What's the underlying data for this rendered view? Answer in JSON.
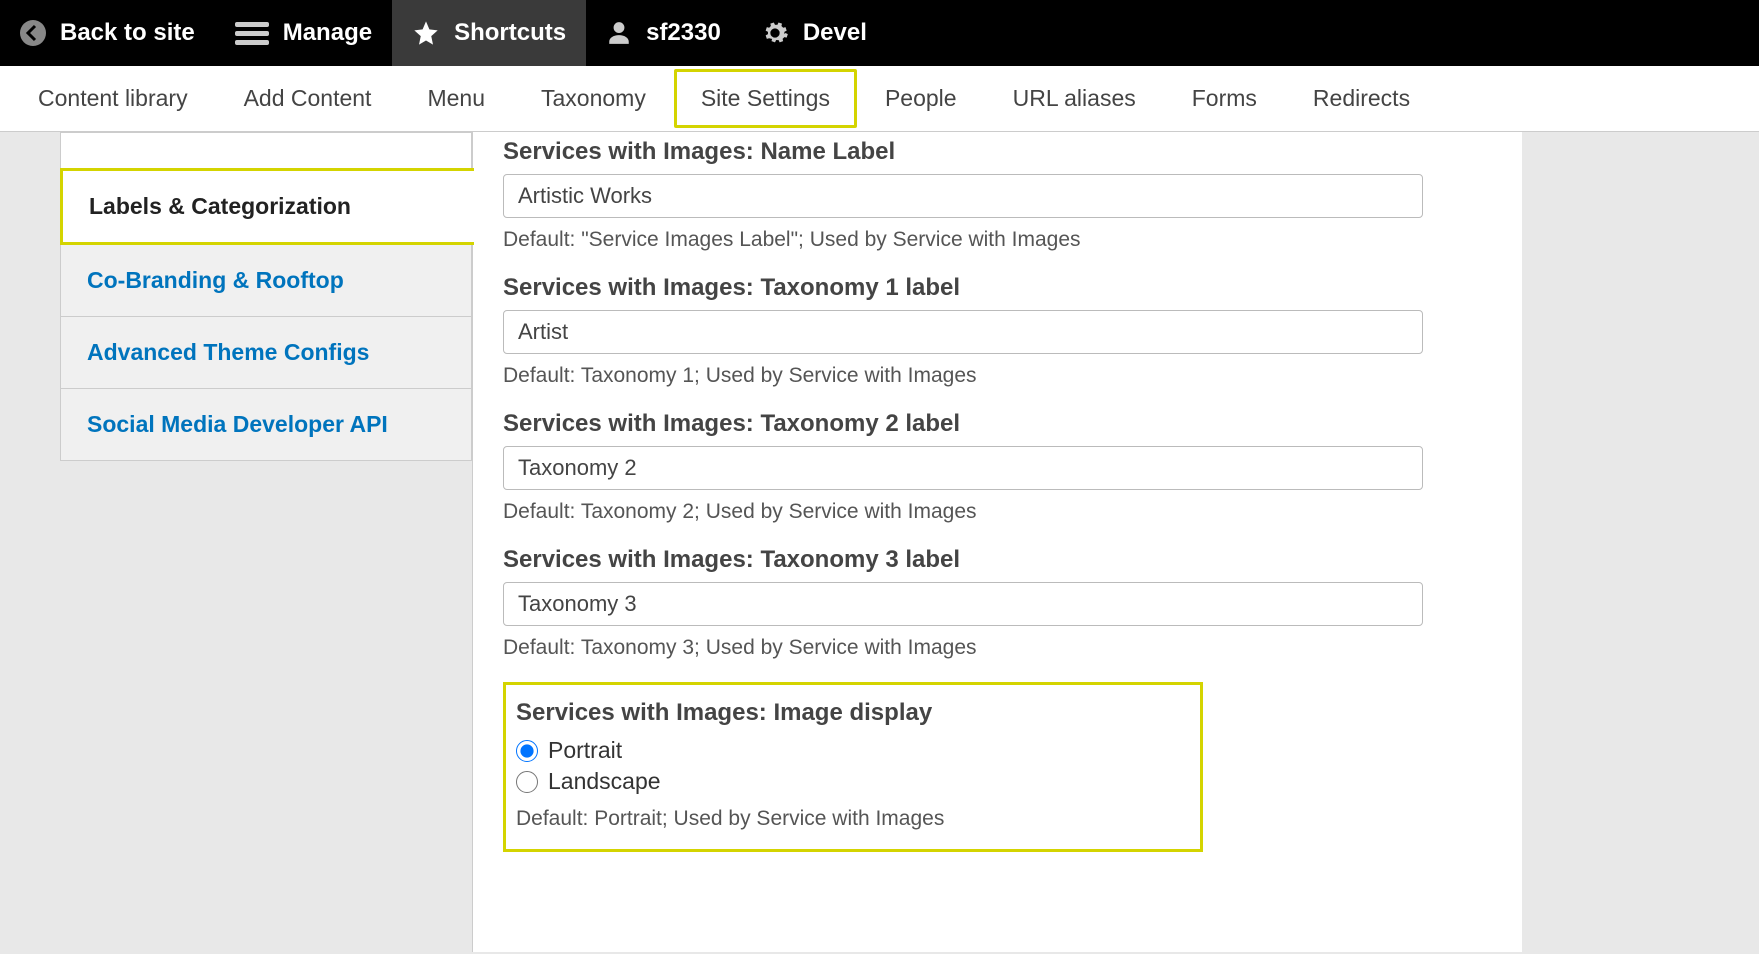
{
  "toolbar": {
    "back": "Back to site",
    "manage": "Manage",
    "shortcuts": "Shortcuts",
    "user": "sf2330",
    "devel": "Devel"
  },
  "secondary_nav": [
    "Content library",
    "Add Content",
    "Menu",
    "Taxonomy",
    "Site Settings",
    "People",
    "URL aliases",
    "Forms",
    "Redirects"
  ],
  "sidebar": {
    "items": [
      "Labels & Categorization",
      "Co-Branding & Rooftop",
      "Advanced Theme Configs",
      "Social Media Developer API"
    ]
  },
  "fields": {
    "name_label": {
      "label": "Services with Images: Name Label",
      "value": "Artistic Works",
      "help": "Default: \"Service Images Label\"; Used by Service with Images"
    },
    "tax1": {
      "label": "Services with Images: Taxonomy 1 label",
      "value": "Artist",
      "help": "Default: Taxonomy 1; Used by Service with Images"
    },
    "tax2": {
      "label": "Services with Images: Taxonomy 2 label",
      "value": "Taxonomy 2",
      "help": "Default: Taxonomy 2; Used by Service with Images"
    },
    "tax3": {
      "label": "Services with Images: Taxonomy 3 label",
      "value": "Taxonomy 3",
      "help": "Default: Taxonomy 3; Used by Service with Images"
    },
    "image_display": {
      "label": "Services with Images: Image display",
      "portrait": "Portrait",
      "landscape": "Landscape",
      "help": "Default: Portrait; Used by Service with Images"
    }
  }
}
